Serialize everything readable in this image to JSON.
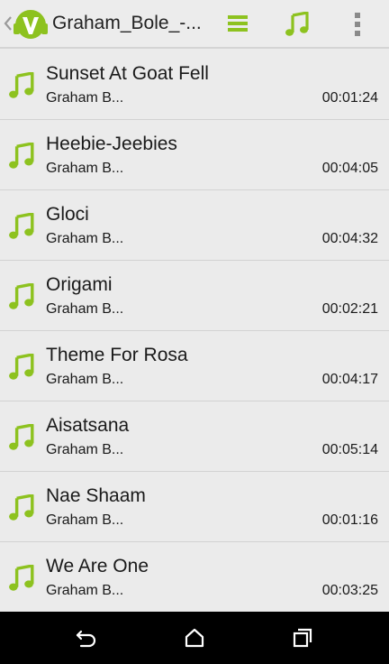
{
  "header": {
    "title": "Graham_Bole_-...",
    "icons": {
      "up": "chevron-left-icon",
      "logo": "app-logo-icon",
      "list": "list-icon",
      "music": "music-note-icon",
      "overflow": "more-vert-icon"
    }
  },
  "colors": {
    "accent": "#8dc21f",
    "background": "#ebebeb",
    "divider": "#d2d2d2",
    "nav_bar": "#000000"
  },
  "tracks": [
    {
      "title": "Sunset At Goat Fell",
      "artist": "Graham B...",
      "duration": "00:01:24"
    },
    {
      "title": "Heebie-Jeebies",
      "artist": "Graham B...",
      "duration": "00:04:05"
    },
    {
      "title": "Gloci",
      "artist": "Graham B...",
      "duration": "00:04:32"
    },
    {
      "title": "Origami",
      "artist": "Graham B...",
      "duration": "00:02:21"
    },
    {
      "title": "Theme For Rosa",
      "artist": "Graham B...",
      "duration": "00:04:17"
    },
    {
      "title": "Aisatsana",
      "artist": "Graham B...",
      "duration": "00:05:14"
    },
    {
      "title": "Nae Shaam",
      "artist": "Graham B...",
      "duration": "00:01:16"
    },
    {
      "title": "We Are One",
      "artist": "Graham B...",
      "duration": "00:03:25"
    }
  ],
  "nav": {
    "back": "back-icon",
    "home": "home-icon",
    "recents": "recents-icon"
  }
}
